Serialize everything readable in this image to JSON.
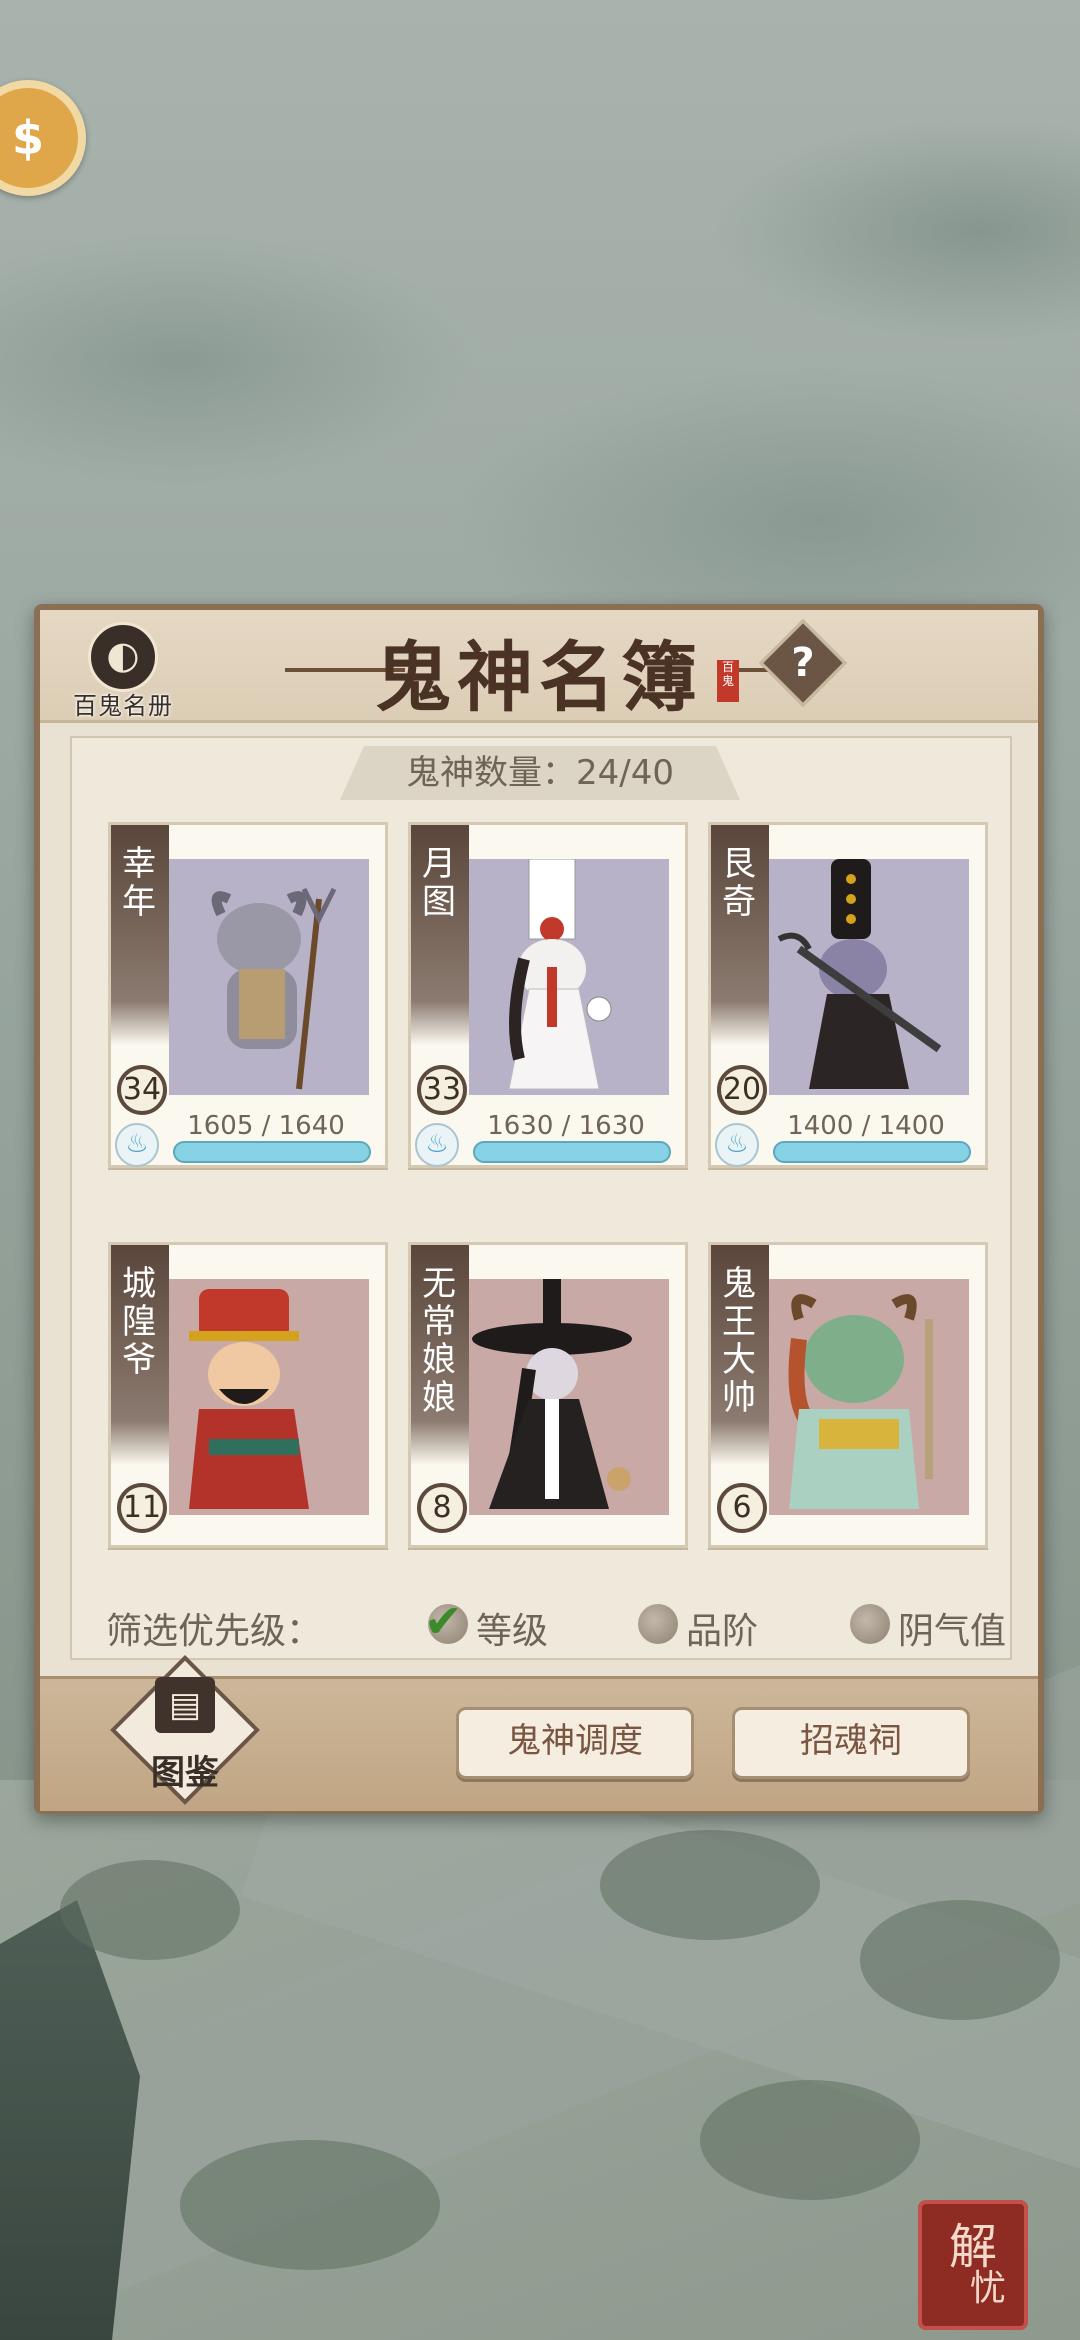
{
  "app": {
    "corner_stamp": [
      "解",
      "忧"
    ],
    "coin_icon": "coin-icon"
  },
  "panel": {
    "title": "鬼神名簿",
    "seal_text": "百鬼",
    "album_label": "百鬼名册",
    "help_label": "?",
    "count_text": "鬼神数量：24/40",
    "ghosts": [
      {
        "name": "幸年",
        "level": "34",
        "hp": "1605 / 1640",
        "hp_fraction": 0.979,
        "bg": "#b8b2c9"
      },
      {
        "name": "月图",
        "level": "33",
        "hp": "1630 / 1630",
        "hp_fraction": 1.0,
        "bg": "#b8b2c9"
      },
      {
        "name": "艮奇",
        "level": "20",
        "hp": "1400 / 1400",
        "hp_fraction": 1.0,
        "bg": "#b8b2c9"
      },
      {
        "name": "城隍爷",
        "level": "11",
        "bg": "#c9a9a6"
      },
      {
        "name": "无常娘娘",
        "level": "8",
        "bg": "#c9a9a6"
      },
      {
        "name": "鬼王大帅",
        "level": "6",
        "bg": "#c9a9a6"
      }
    ],
    "filter": {
      "label": "筛选优先级：",
      "options": [
        {
          "label": "等级",
          "selected": true
        },
        {
          "label": "品阶",
          "selected": false
        },
        {
          "label": "阴气值",
          "selected": false
        }
      ]
    },
    "footer": {
      "codex_label": "图鉴",
      "dispatch_label": "鬼神调度",
      "summon_label": "招魂祠"
    }
  }
}
